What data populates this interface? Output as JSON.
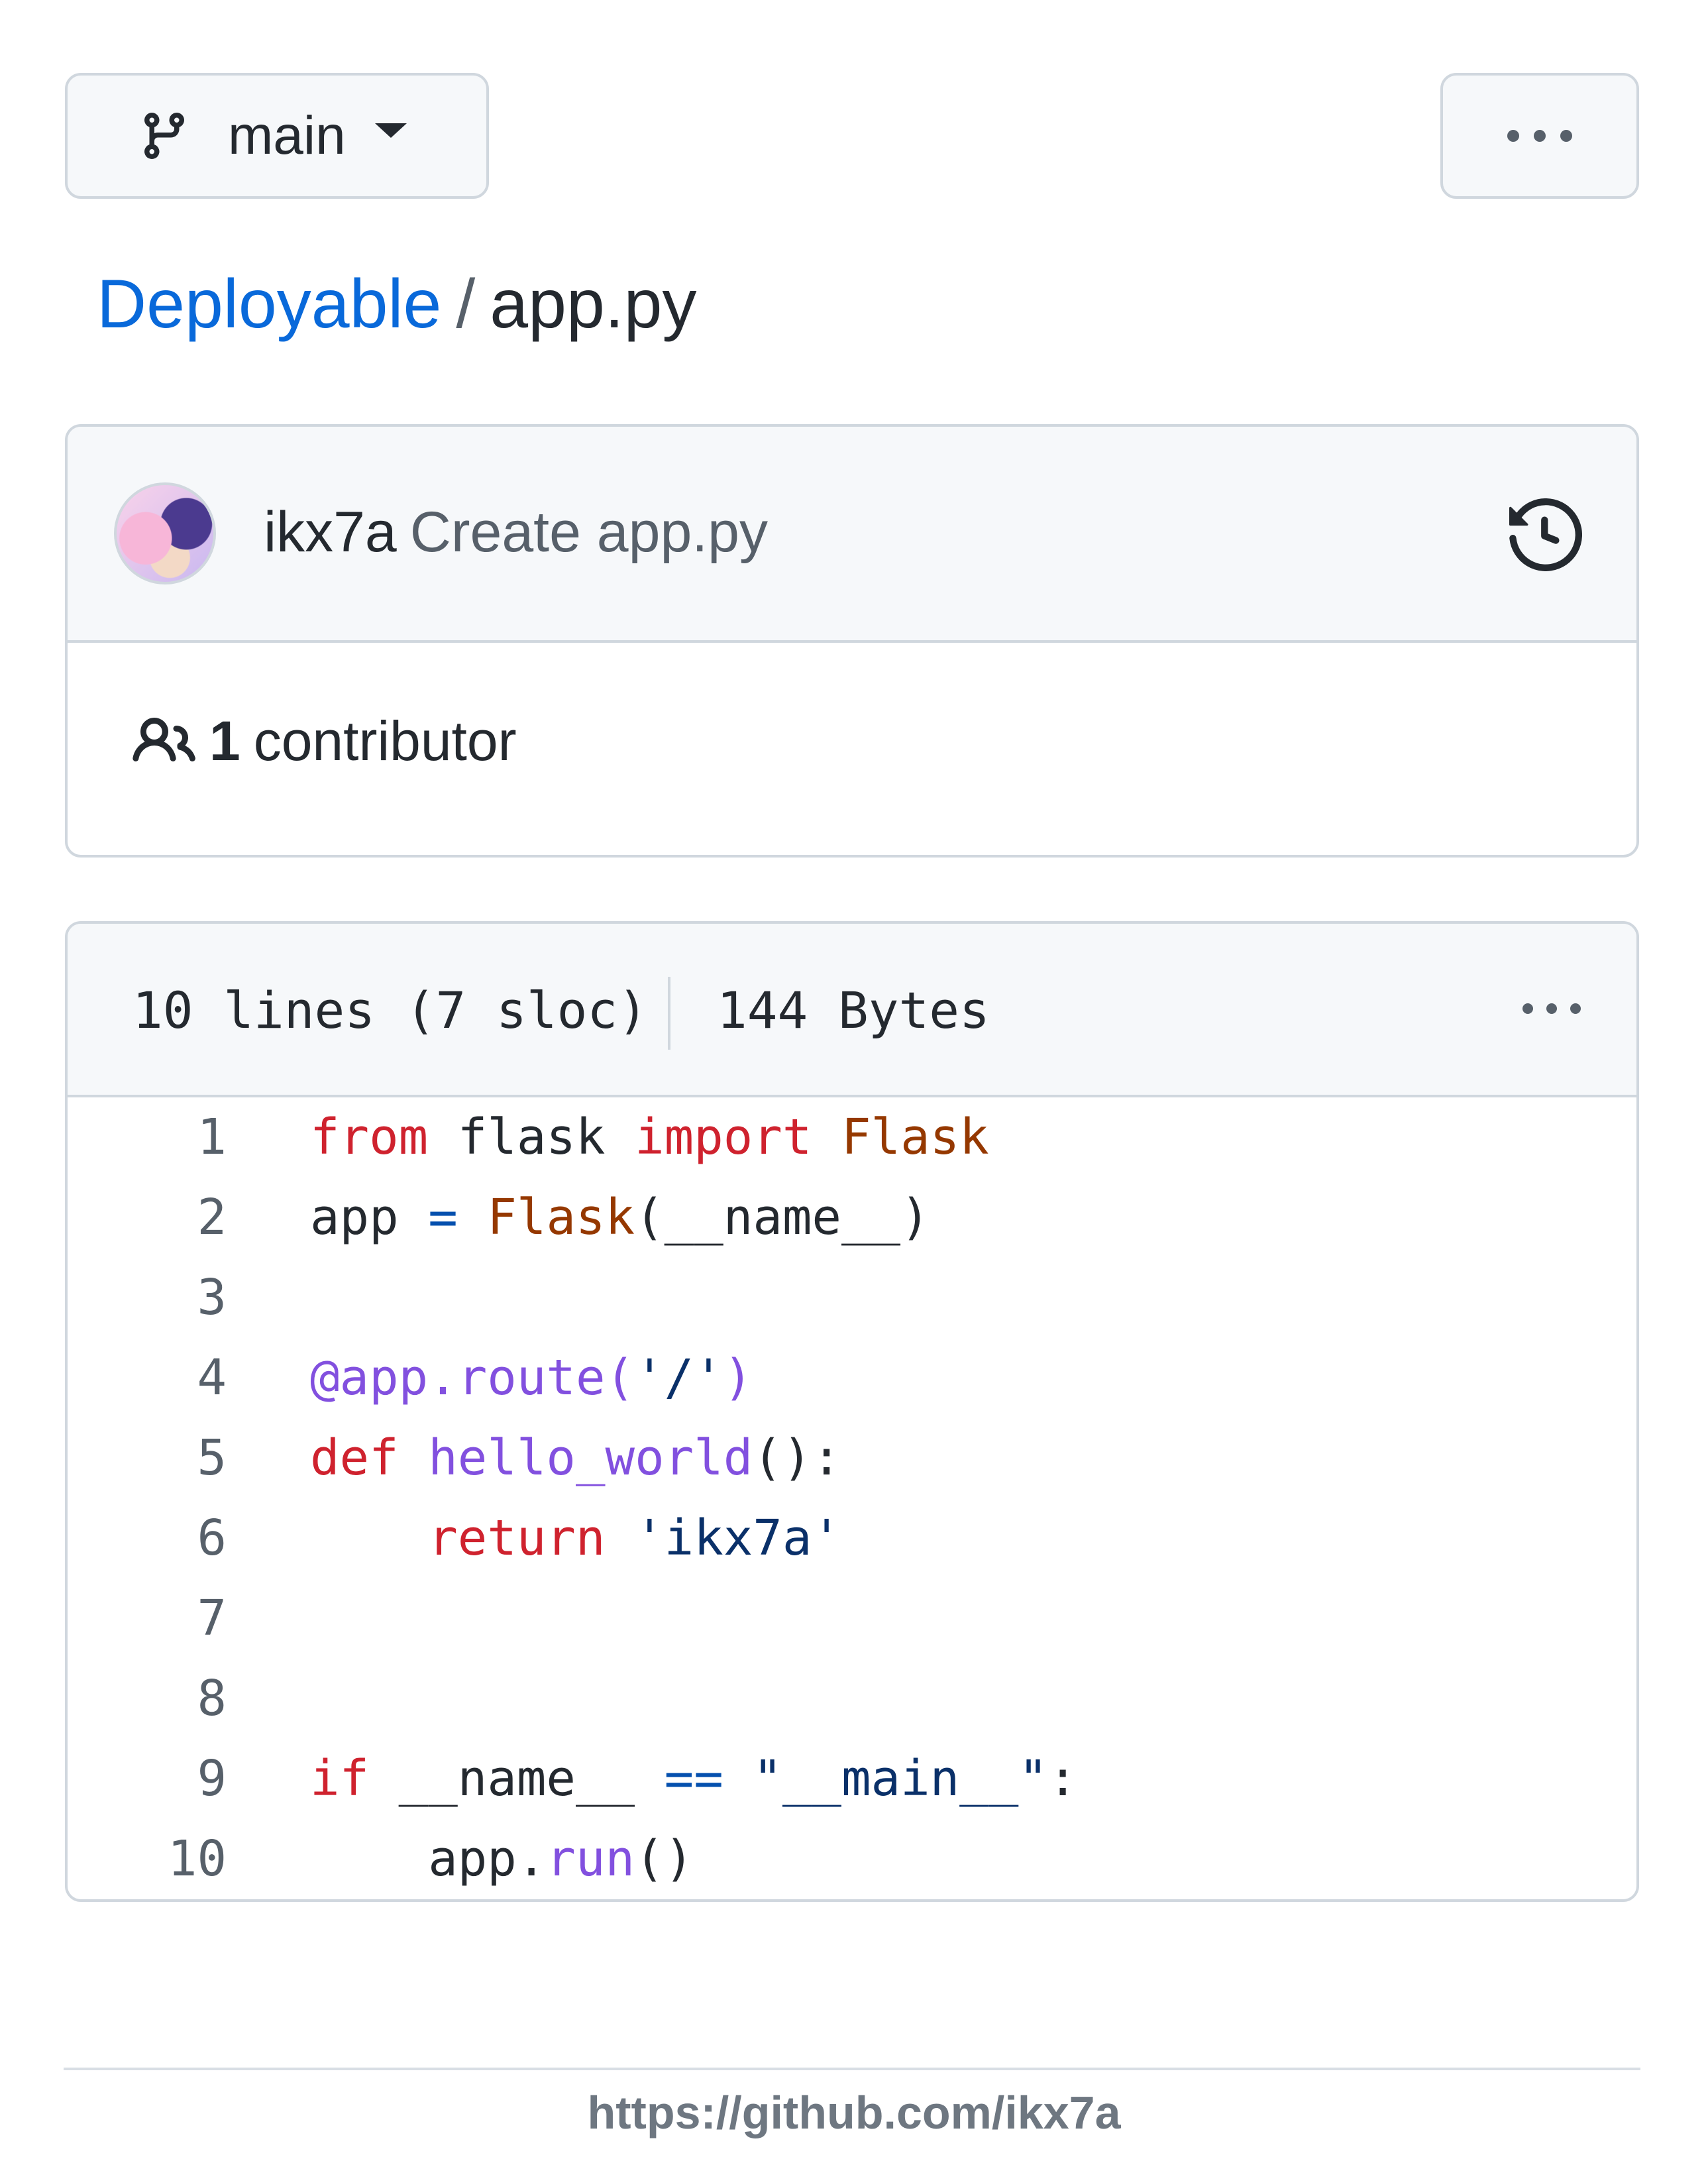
{
  "toolbar": {
    "branch_label": "main",
    "branch_icon": "git-branch-icon",
    "more_icon": "kebab-horizontal-icon"
  },
  "breadcrumb": {
    "repo": "Deployable",
    "separator": "/",
    "file": "app.py"
  },
  "commit": {
    "author": "ikx7a",
    "message": "Create app.py",
    "history_icon": "history-icon",
    "contributors_count": "1",
    "contributors_label": "contributor"
  },
  "file_info": {
    "lines": "10 lines (7 sloc)",
    "size": "144 Bytes"
  },
  "code": {
    "language": "python",
    "line_numbers": [
      "1",
      "2",
      "3",
      "4",
      "5",
      "6",
      "7",
      "8",
      "9",
      "10"
    ],
    "lines": [
      "from flask import Flask",
      "app = Flask(__name__)",
      "",
      "@app.route('/')",
      "def hello_world():",
      "    return 'ikx7a'",
      "",
      "",
      "if __name__ == \"__main__\":",
      "    app.run()"
    ]
  },
  "colors": {
    "link": "#0969da",
    "keyword": "#cf222e",
    "class": "#953800",
    "function": "#8250df",
    "string": "#0a3069",
    "operator": "#0550ae"
  },
  "footer": {
    "url": "https://github.com/ikx7a"
  }
}
